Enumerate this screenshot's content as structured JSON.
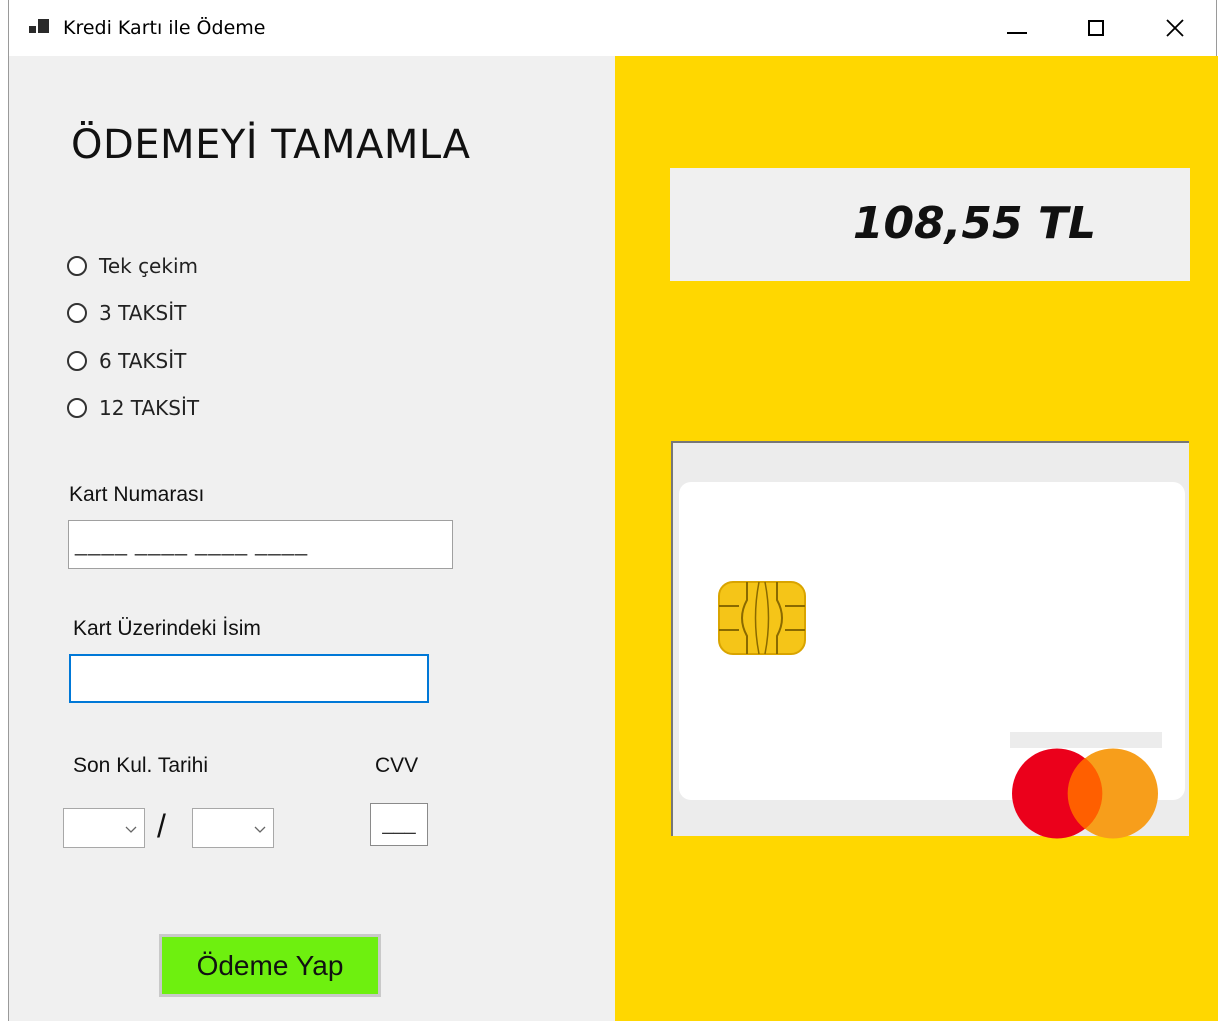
{
  "window": {
    "title": "Kredi Kartı ile Ödeme",
    "controls": [
      "minimize",
      "maximize",
      "close"
    ]
  },
  "form": {
    "heading": "ÖDEMEYİ TAMAMLA",
    "installments": [
      {
        "label": "Tek çekim",
        "selected": false
      },
      {
        "label": "3 TAKSİT",
        "selected": false
      },
      {
        "label": "6 TAKSİT",
        "selected": false
      },
      {
        "label": "12 TAKSİT",
        "selected": false
      }
    ],
    "card_number": {
      "label": "Kart Numarası",
      "value": "____ ____ ____ ____"
    },
    "card_name": {
      "label": "Kart Üzerindeki İsim",
      "value": ""
    },
    "expiry": {
      "label": "Son Kul. Tarihi",
      "separator": "/",
      "month": "",
      "year": ""
    },
    "cvv": {
      "label": "CVV",
      "value": "___"
    },
    "pay_button": "Ödeme Yap"
  },
  "summary": {
    "amount": "108,55 TL"
  },
  "colors": {
    "panel_accent": "#ffd700",
    "pay_button": "#6ef00f",
    "mastercard_red": "#eb001b",
    "mastercard_orange": "#f79e1b"
  }
}
